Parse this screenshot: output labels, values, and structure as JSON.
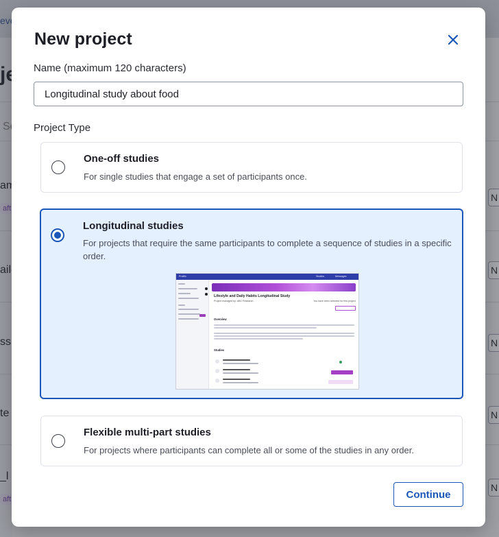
{
  "background": {
    "fragments": [
      "eve",
      "je",
      "Se",
      "am",
      "ail-",
      "ss",
      "te",
      "_l",
      "N",
      "N",
      "N",
      "N",
      "N"
    ],
    "pills": [
      "aft",
      "aft"
    ]
  },
  "modal": {
    "title": "New project",
    "name_label": "Name (maximum 120 characters)",
    "name_value": "Longitudinal study about food",
    "project_type_label": "Project Type",
    "options": [
      {
        "title": "One-off studies",
        "description": "For single studies that engage a set of participants once.",
        "selected": false
      },
      {
        "title": "Longitudinal studies",
        "description": "For projects that require the same participants to complete a sequence of studies in a specific order.",
        "selected": true
      },
      {
        "title": "Flexible multi-part studies",
        "description": "For projects where participants can complete all or some of the studies in any order.",
        "selected": false
      }
    ],
    "continue_label": "Continue"
  },
  "preview": {
    "brand": "Prolific",
    "nav_tabs": [
      "Studies",
      "Messages"
    ],
    "title": "Lifestyle and Daily Habits Longitudinal Study",
    "organisation": "Project managed by: ABC Research",
    "invited_note": "You have been selected for this project",
    "leave_label": "Leave study",
    "overview_heading": "Overview",
    "studies_heading": "Studies",
    "steps": [
      "Part 1 - Baseline Survey",
      "Part 2 - Follow-up Survey",
      "Part 3 - Follow-up Survey"
    ],
    "completed_label": "Completed",
    "start_label": "Start study",
    "available_label": "Available later"
  },
  "colors": {
    "accent": "#1a57b8",
    "selected_bg": "#e5f0ff",
    "preview_banner": "#b24fd8"
  },
  "icons": {
    "close": "close-icon"
  }
}
